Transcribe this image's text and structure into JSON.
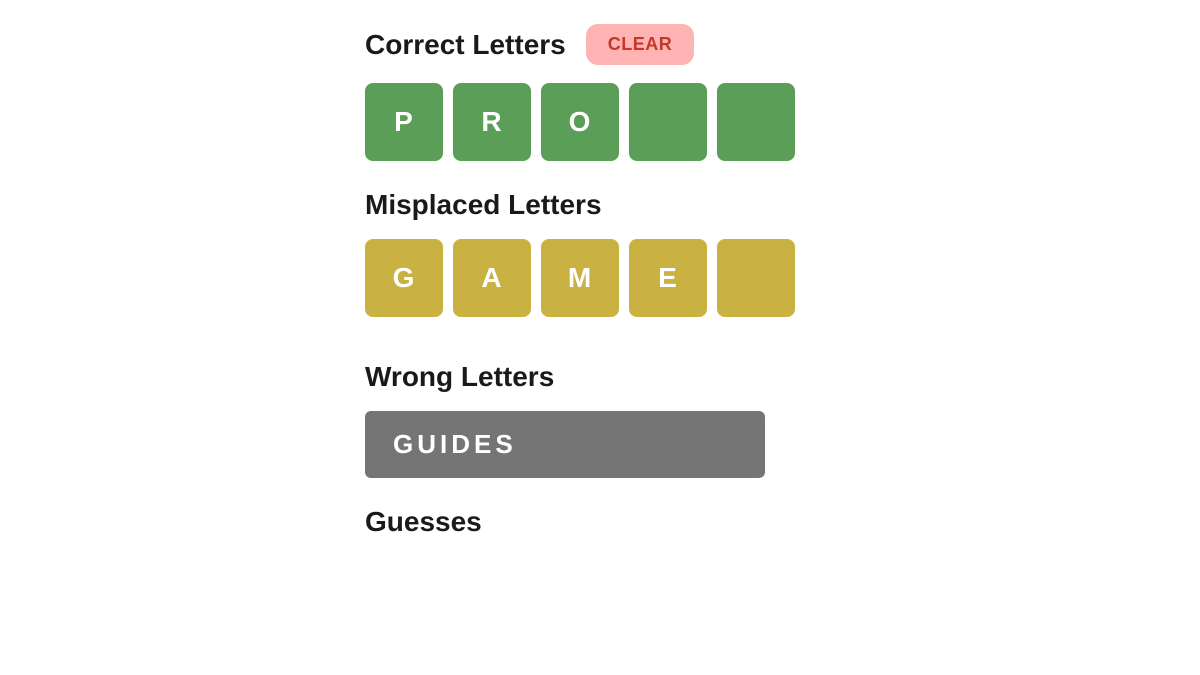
{
  "sections": {
    "correct_letters": {
      "title": "Correct Letters",
      "clear_button": "CLEAR",
      "tiles": [
        {
          "letter": "P",
          "empty": false
        },
        {
          "letter": "R",
          "empty": false
        },
        {
          "letter": "O",
          "empty": false
        },
        {
          "letter": "",
          "empty": true
        },
        {
          "letter": "",
          "empty": true
        }
      ]
    },
    "misplaced_letters": {
      "title": "Misplaced Letters",
      "tiles": [
        {
          "letter": "G",
          "empty": false
        },
        {
          "letter": "A",
          "empty": false
        },
        {
          "letter": "M",
          "empty": false
        },
        {
          "letter": "E",
          "empty": false
        },
        {
          "letter": "",
          "empty": true
        }
      ]
    },
    "wrong_letters": {
      "title": "Wrong Letters",
      "value": "GUIDES"
    },
    "guesses": {
      "title": "Guesses"
    }
  },
  "colors": {
    "green": "#5a9e57",
    "yellow": "#c9b142",
    "gray": "#757575",
    "clear_bg": "#ffb3b3",
    "clear_text": "#c0392b"
  }
}
